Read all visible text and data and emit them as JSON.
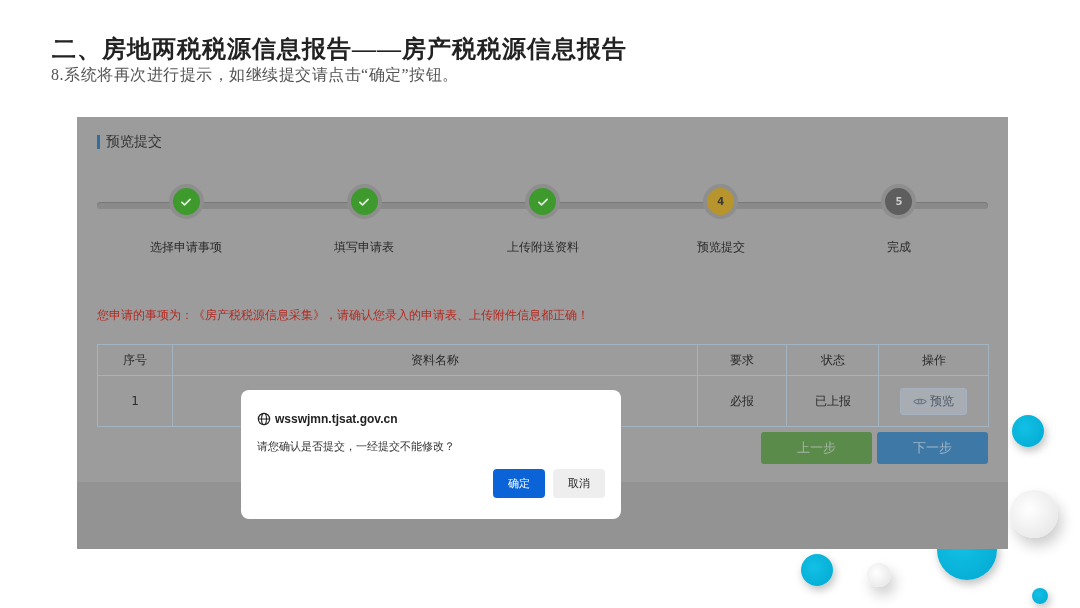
{
  "slide": {
    "title": "二、房地两税税源信息报告——房产税税源信息报告",
    "instruction": "8.系统将再次进行提示，如继续提交请点击“确定”按钮。"
  },
  "screenshot": {
    "section_title": "预览提交",
    "steps": [
      {
        "label": "选择申请事项",
        "completed": true,
        "current": false
      },
      {
        "label": "填写申请表",
        "completed": true,
        "current": false
      },
      {
        "label": "上传附送资料",
        "completed": true,
        "current": false
      },
      {
        "label": "预览提交",
        "number": "4",
        "completed": false,
        "current": true
      },
      {
        "label": "完成",
        "number": "5",
        "completed": false,
        "current": false
      }
    ],
    "notice": "您申请的事项为：《房产税税源信息采集》，请确认您录入的申请表、上传附件信息都正确！",
    "table": {
      "columns": [
        "序号",
        "资料名称",
        "要求",
        "状态",
        "操作"
      ],
      "rows": [
        {
          "index": "1",
          "requirement": "必报",
          "status": "已上报",
          "action": "预览"
        }
      ]
    },
    "buttons": [
      {
        "label": "上一步",
        "kind": "back"
      },
      {
        "label": "下一步",
        "kind": "next"
      }
    ],
    "dialog": {
      "origin": "wsswjmn.tjsat.gov.cn",
      "message": "请您确认是否提交，一经提交不能修改？",
      "buttons": [
        {
          "label": "确定",
          "kind": "primary"
        },
        {
          "label": "取消",
          "kind": "secondary"
        }
      ]
    }
  }
}
